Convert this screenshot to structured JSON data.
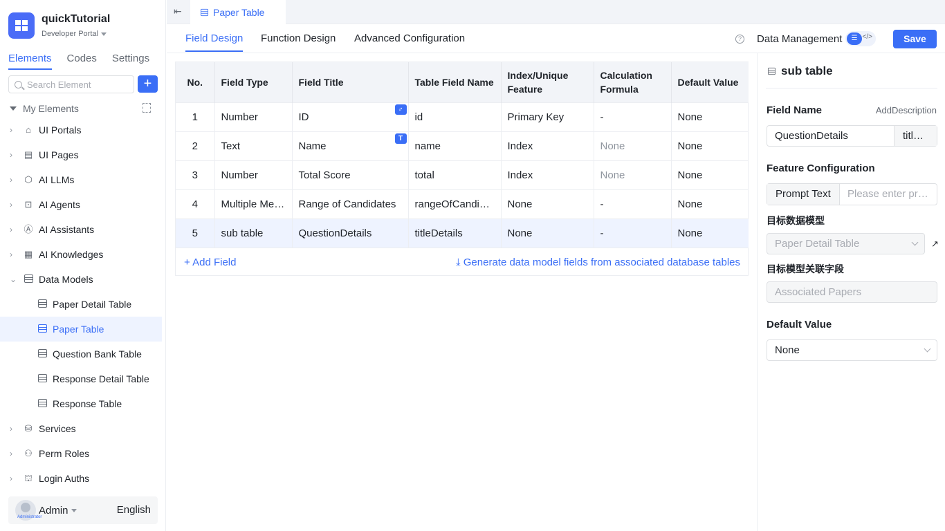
{
  "app": {
    "title": "quickTutorial",
    "portal": "Developer Portal"
  },
  "sidebar": {
    "tabs": [
      "Elements",
      "Codes",
      "Settings"
    ],
    "search_placeholder": "Search Element",
    "add_label": "+",
    "tree_header": "My Elements",
    "items": [
      {
        "label": "UI Portals",
        "icon": "home-icon",
        "glyph": "⌂"
      },
      {
        "label": "UI Pages",
        "icon": "page-icon",
        "glyph": "▤"
      },
      {
        "label": "AI LLMs",
        "icon": "cube-icon",
        "glyph": "⬡"
      },
      {
        "label": "AI Agents",
        "icon": "robot-icon",
        "glyph": "⊡"
      },
      {
        "label": "AI Assistants",
        "icon": "assistant-icon",
        "glyph": "Ⓐ"
      },
      {
        "label": "AI Knowledges",
        "icon": "book-icon",
        "glyph": "▦"
      },
      {
        "label": "Data Models",
        "icon": "table-icon",
        "glyph": ""
      }
    ],
    "data_models": [
      "Paper Detail Table",
      "Paper Table",
      "Question Bank Table",
      "Response Detail Table",
      "Response Table"
    ],
    "items_after": [
      {
        "label": "Services",
        "icon": "service-icon",
        "glyph": "⛁"
      },
      {
        "label": "Perm Roles",
        "icon": "roles-icon",
        "glyph": "⚇"
      },
      {
        "label": "Login Auths",
        "icon": "auth-icon",
        "glyph": "⛫"
      }
    ],
    "user": {
      "name": "Admin",
      "role": "Administrator",
      "language": "English"
    }
  },
  "topbar": {
    "tab_label": "Paper Table"
  },
  "subnav": {
    "tabs": [
      "Field Design",
      "Function Design",
      "Advanced Configuration"
    ],
    "help": "?",
    "data_management": "Data Management",
    "save": "Save"
  },
  "table": {
    "columns": [
      "No.",
      "Field Type",
      "Field Title",
      "Table Field Name",
      "Index/Unique Feature",
      "Calculation Formula",
      "Default Value"
    ],
    "rows": [
      {
        "no": "1",
        "type": "Number",
        "title": "ID",
        "badge": "♂",
        "field": "id",
        "index": "Primary Key",
        "formula": "-",
        "formula_muted": false,
        "default": "None"
      },
      {
        "no": "2",
        "type": "Text",
        "title": "Name",
        "badge": "T",
        "field": "name",
        "index": "Index",
        "formula": "None",
        "formula_muted": true,
        "default": "None"
      },
      {
        "no": "3",
        "type": "Number",
        "title": "Total Score",
        "badge": "",
        "field": "total",
        "index": "Index",
        "formula": "None",
        "formula_muted": true,
        "default": "None"
      },
      {
        "no": "4",
        "type": "Multiple Me…",
        "title": "Range of Candidates",
        "badge": "",
        "field": "rangeOfCandid…",
        "index": "None",
        "formula": "-",
        "formula_muted": false,
        "default": "None"
      },
      {
        "no": "5",
        "type": "sub table",
        "title": "QuestionDetails",
        "badge": "",
        "field": "titleDetails",
        "index": "None",
        "formula": "-",
        "formula_muted": false,
        "default": "None"
      }
    ],
    "selected_row": 4,
    "add_field": "+ Add Field",
    "generate": "⤓ Generate data model fields from associated database tables"
  },
  "panel": {
    "title": "sub table",
    "field_name_label": "Field Name",
    "add_description": "AddDescription",
    "field_name_value": "QuestionDetails",
    "field_name_value2": "titl…",
    "feature_label": "Feature Configuration",
    "prompt_label": "Prompt Text",
    "prompt_placeholder": "Please enter pr…",
    "target_model_label": "目标数据模型",
    "target_model_value": "Paper Detail Table",
    "target_field_label": "目标模型关联字段",
    "target_field_value": "Associated Papers",
    "default_label": "Default Value",
    "default_value": "None"
  },
  "colors": {
    "accent": "#3a6ef6",
    "selected_bg": "#eef3ff",
    "header_bg": "#f2f4f8"
  }
}
